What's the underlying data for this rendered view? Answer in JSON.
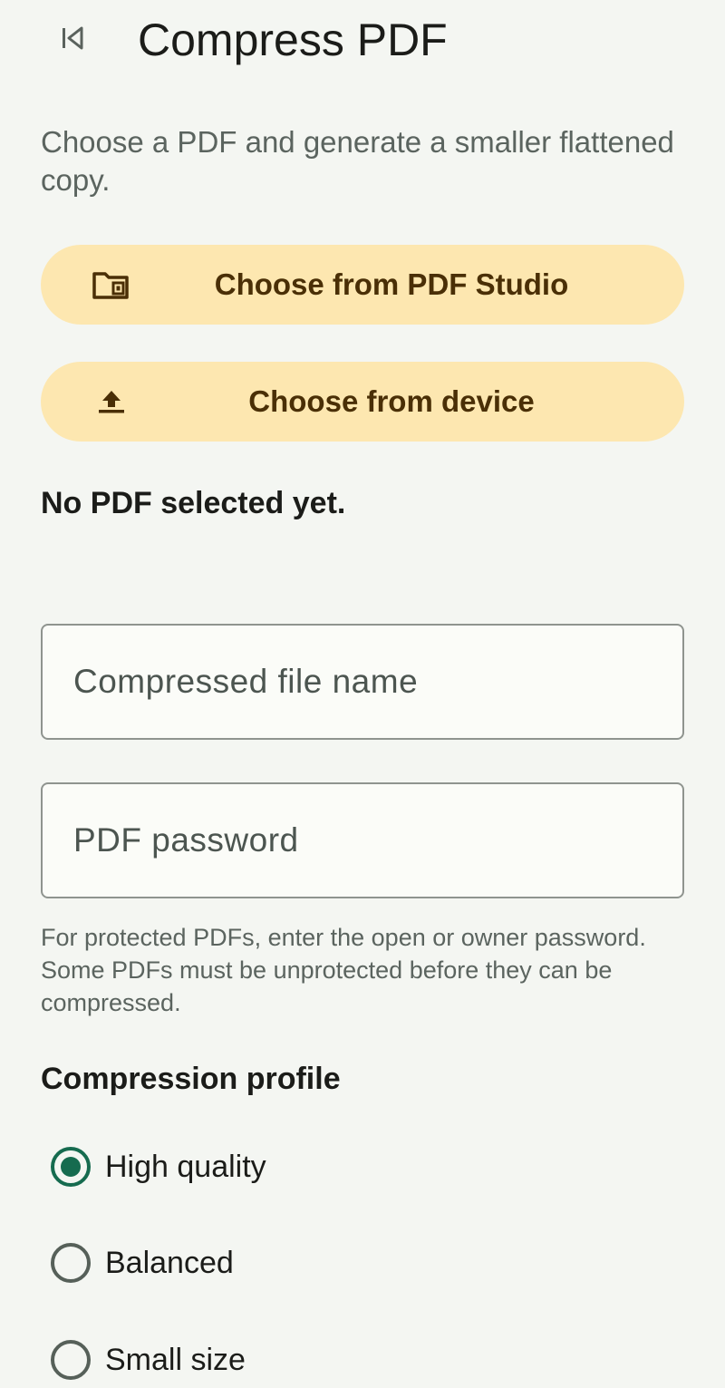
{
  "header": {
    "title": "Compress PDF",
    "back_icon": "back-icon"
  },
  "intro": {
    "text": "Choose a PDF and generate a smaller flattened copy."
  },
  "actions": {
    "studio_label": "Choose from PDF Studio",
    "studio_icon": "folder-pdf-icon",
    "device_label": "Choose from device",
    "device_icon": "upload-icon"
  },
  "status": {
    "text": "No PDF selected yet."
  },
  "fields": {
    "file_name_placeholder": "Compressed file name",
    "file_name_value": "",
    "password_placeholder": "PDF password",
    "password_value": "",
    "password_helper": "For protected PDFs, enter the open or owner password. Some PDFs must be unprotected before they can be compressed."
  },
  "profile": {
    "title": "Compression profile",
    "options": [
      {
        "label": "High quality",
        "selected": true
      },
      {
        "label": "Balanced",
        "selected": false
      },
      {
        "label": "Small size",
        "selected": false
      }
    ]
  },
  "colors": {
    "background": "#f4f6f2",
    "button_fill": "#fde7b0",
    "button_text": "#4a2f06",
    "radio_selected": "#166b4f"
  }
}
